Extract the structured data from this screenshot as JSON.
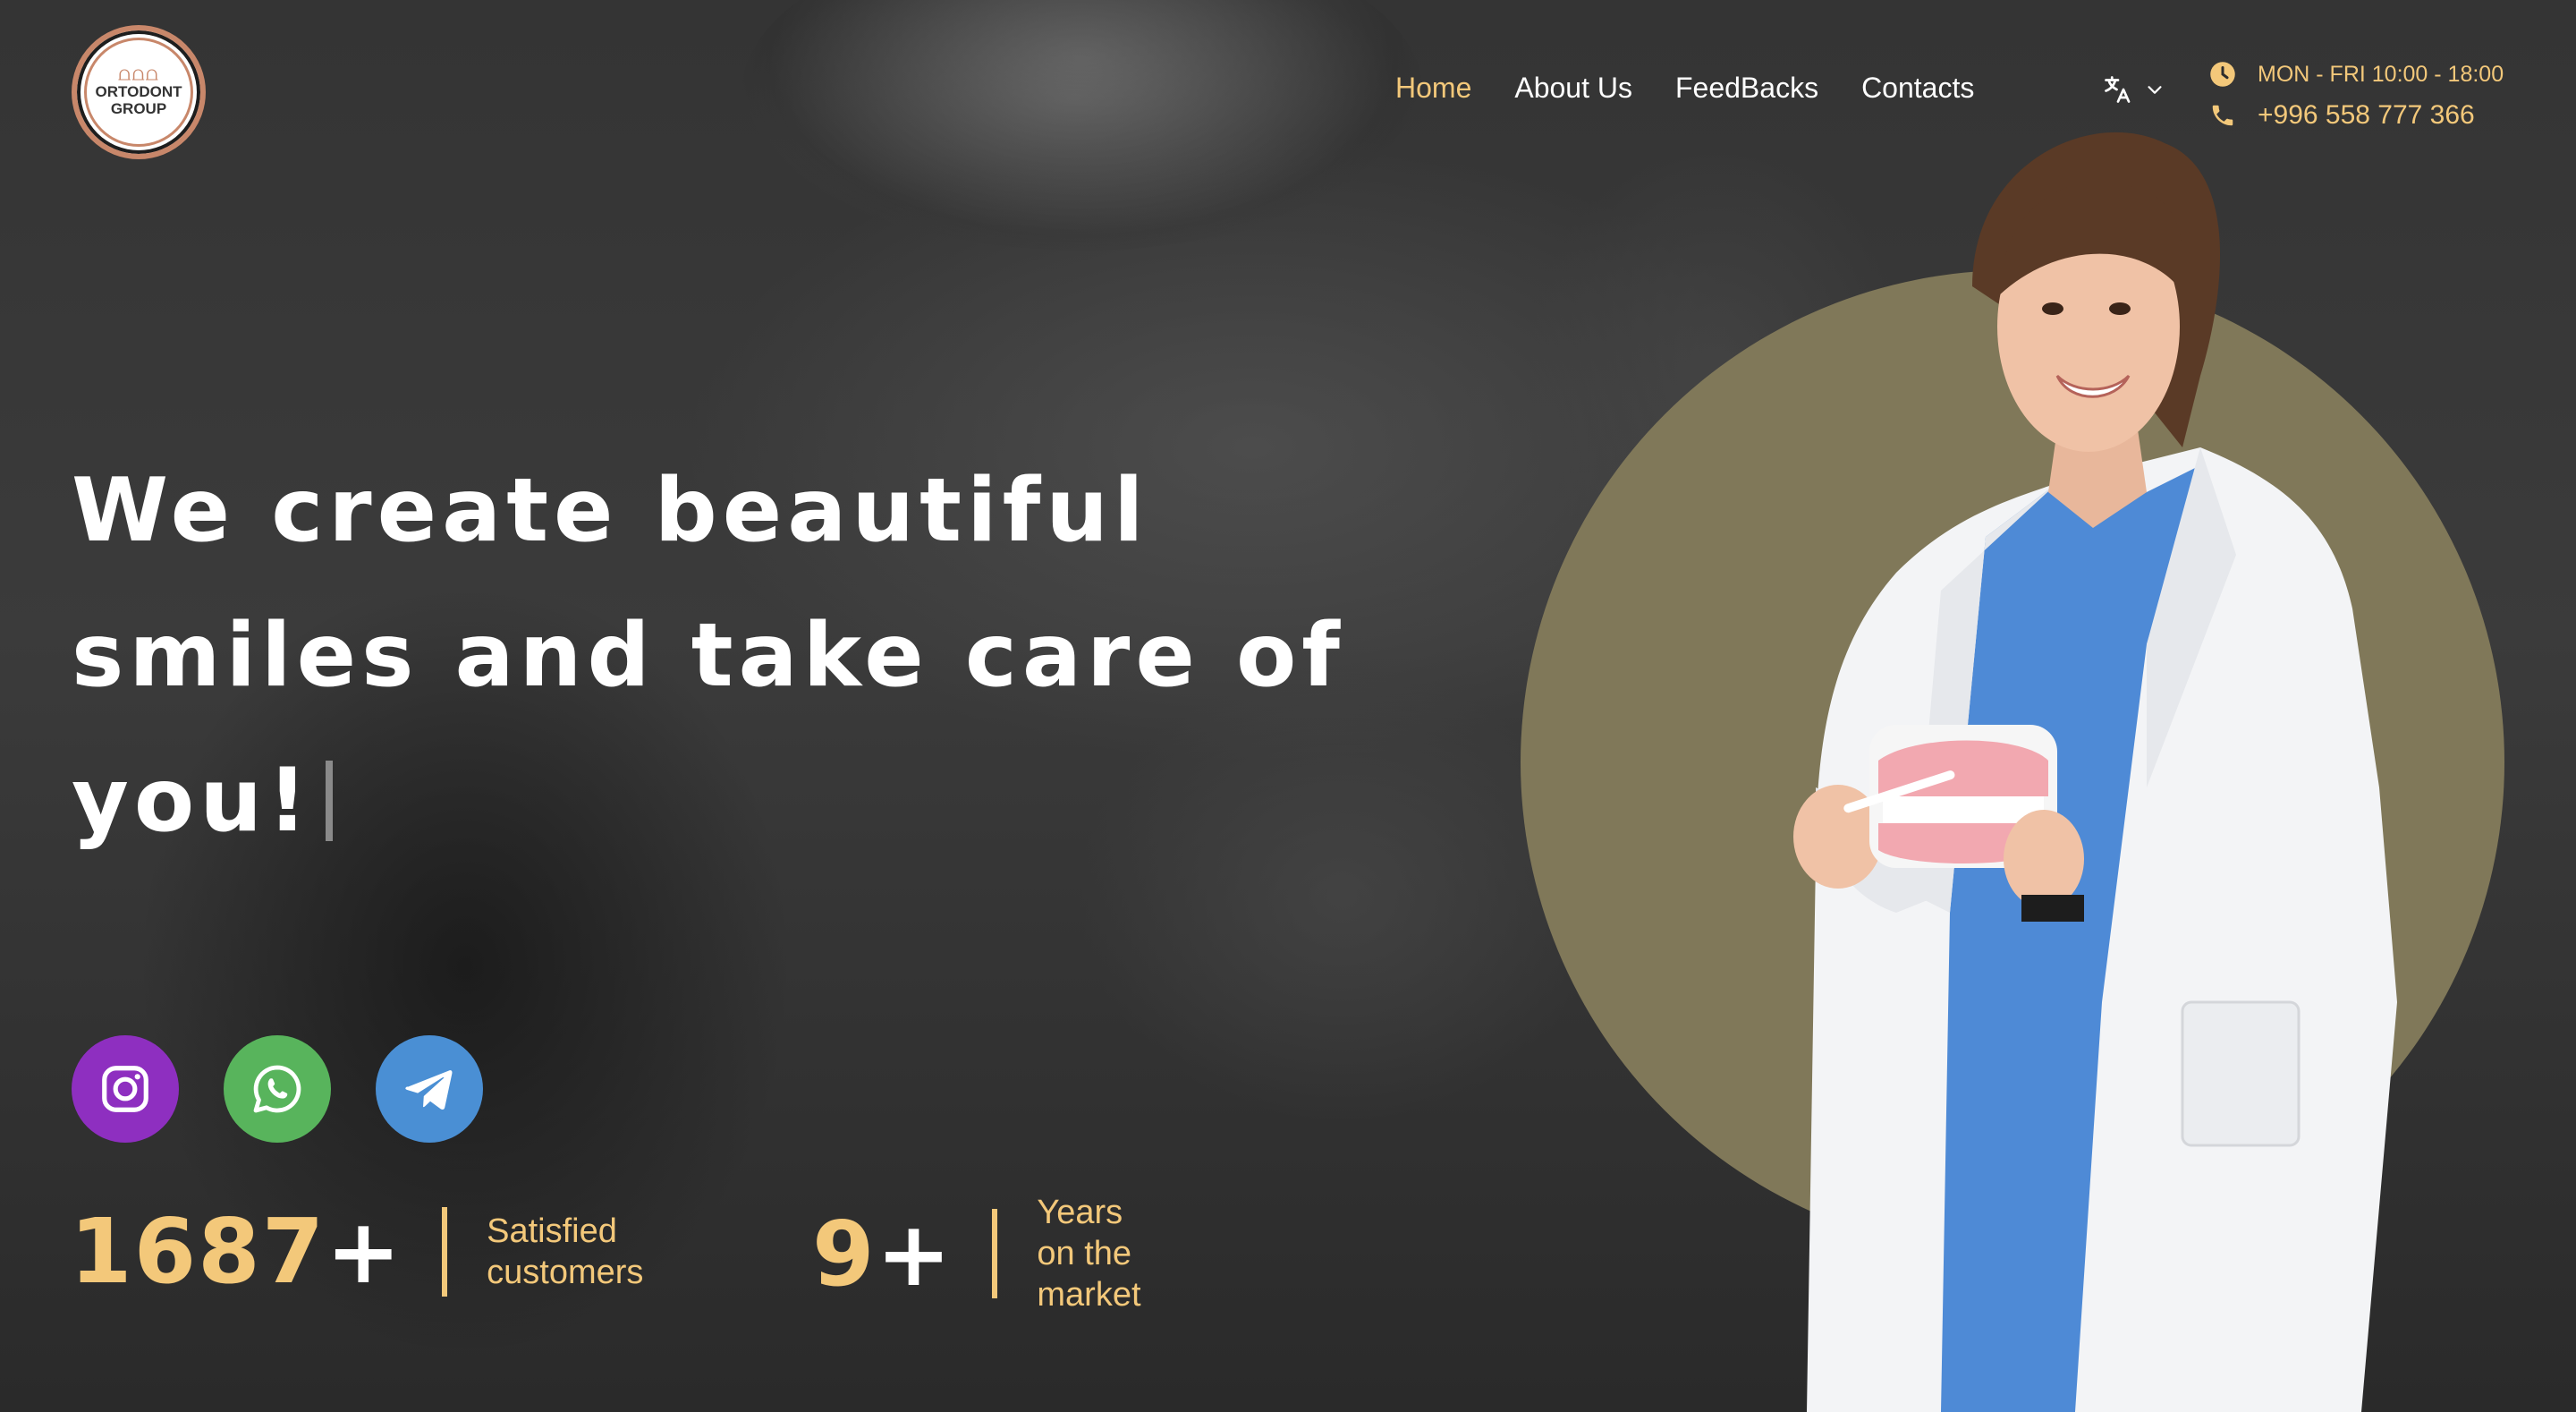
{
  "brand": {
    "logo_text": "ORTODONT GROUP"
  },
  "nav": {
    "items": [
      {
        "label": "Home",
        "active": true
      },
      {
        "label": "About Us",
        "active": false
      },
      {
        "label": "FeedBacks",
        "active": false
      },
      {
        "label": "Contacts",
        "active": false
      }
    ],
    "language_icon": "translate-icon"
  },
  "contact": {
    "hours": "MON - FRI 10:00 - 18:00",
    "phone": "+996 558 777 366",
    "hours_icon": "clock-icon",
    "phone_icon": "phone-icon"
  },
  "hero": {
    "lines": [
      "We create beautiful",
      "smiles and take care of",
      "you!"
    ]
  },
  "socials": [
    {
      "name": "instagram",
      "icon": "instagram-icon",
      "color": "#8e2fc0"
    },
    {
      "name": "whatsapp",
      "icon": "whatsapp-icon",
      "color": "#58b45c"
    },
    {
      "name": "telegram",
      "icon": "telegram-icon",
      "color": "#4a8fd4"
    }
  ],
  "stats": [
    {
      "number": "1687",
      "suffix": "+",
      "label_lines": [
        "Satisfied",
        "customers"
      ]
    },
    {
      "number": "9",
      "suffix": "+",
      "label_lines": [
        "Years",
        "on the",
        "market"
      ]
    }
  ],
  "colors": {
    "accent": "#f3c87a",
    "circle": "#807859",
    "background": "#2c2c2c"
  }
}
